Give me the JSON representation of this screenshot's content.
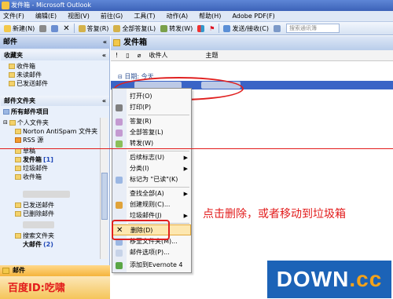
{
  "window": {
    "title": "发件箱 - Microsoft Outlook"
  },
  "menu": [
    "文件(F)",
    "编辑(E)",
    "视图(V)",
    "前往(G)",
    "工具(T)",
    "动作(A)",
    "帮助(H)",
    "Adobe PDF(F)"
  ],
  "toolbar": {
    "new": "新建(N)",
    "reply": "答复(R)",
    "reply_all": "全部答复(L)",
    "forward": "转发(W)",
    "send_receive": "发送/接收(C)",
    "search_placeholder": "搜索通讯簿"
  },
  "nav": {
    "title": "邮件",
    "favorites_header": "收藏夹",
    "favorites": [
      "收件箱",
      "未读邮件",
      "已发送邮件"
    ],
    "folders_header": "邮件文件夹",
    "all_items": "所有邮件项目",
    "personal": "个人文件夹",
    "folders": [
      {
        "label": "Norton AntiSpam 文件夹"
      },
      {
        "label": "RSS 源"
      },
      {
        "label": "草稿"
      },
      {
        "label": "发件箱",
        "count": "[1]"
      },
      {
        "label": "垃圾邮件"
      },
      {
        "label": "收件箱"
      },
      {
        "label": "已发送邮件"
      },
      {
        "label": "已删除邮件"
      },
      {
        "label": "搜索文件夹"
      },
      {
        "label": "大邮件",
        "count": "(2)"
      }
    ],
    "mail_button": "邮件"
  },
  "main": {
    "folder_title": "发件箱",
    "columns": {
      "from": "收件人",
      "subject": "主题"
    },
    "group_label": "日期: 今天"
  },
  "context_menu": [
    {
      "label": "打开(O)"
    },
    {
      "label": "打印(P)"
    },
    {
      "label": "答复(R)"
    },
    {
      "label": "全部答复(L)"
    },
    {
      "label": "转发(W)"
    },
    {
      "label": "后续标志(U)",
      "submenu": true
    },
    {
      "label": "分类(I)",
      "submenu": true
    },
    {
      "label": "标记为 \"已读\"(K)"
    },
    {
      "label": "查找全部(A)",
      "submenu": true
    },
    {
      "label": "创建规则(C)..."
    },
    {
      "label": "垃圾邮件(J)",
      "submenu": true
    },
    {
      "label": "删除(D)"
    },
    {
      "label": "移至文件夹(M)..."
    },
    {
      "label": "邮件选项(P)..."
    },
    {
      "label": "添加到Evernote 4"
    }
  ],
  "annotation": "点击删除，或者移动到垃圾箱",
  "watermark": "百度ID:吃啸",
  "logo": {
    "main": "DOWN",
    "suffix": ".cc"
  },
  "colors": {
    "accent": "#3a64c6",
    "annotation": "#e21b1b",
    "highlight": "#fde7b0"
  }
}
